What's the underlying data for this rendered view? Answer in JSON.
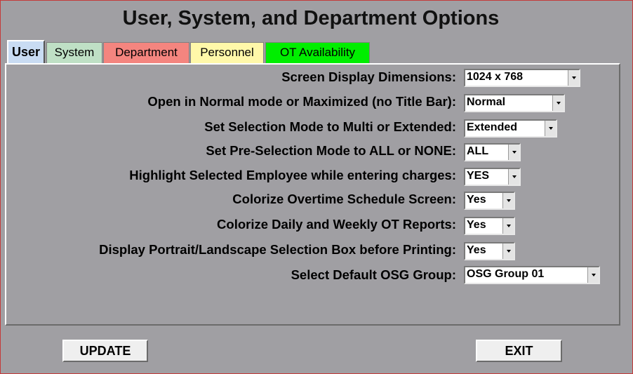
{
  "window_title": "User, System, and Department Options",
  "tabs": [
    {
      "label": "User",
      "color": "#c9dcf3",
      "active": true
    },
    {
      "label": "System",
      "color": "#bfe0c5",
      "active": false
    },
    {
      "label": "Department",
      "color": "#f4857f",
      "active": false
    },
    {
      "label": "Personnel",
      "color": "#fff8a9",
      "active": false
    },
    {
      "label": "OT Availability",
      "color": "#00ee00",
      "active": false
    }
  ],
  "options": [
    {
      "label": "Screen Display Dimensions:",
      "value": "1024 x 768"
    },
    {
      "label": "Open in Normal mode or Maximized (no Title Bar):",
      "value": "Normal"
    },
    {
      "label": "Set Selection Mode to Multi or Extended:",
      "value": "Extended"
    },
    {
      "label": "Set Pre-Selection Mode to ALL or NONE:",
      "value": "ALL"
    },
    {
      "label": "Highlight Selected Employee while entering charges:",
      "value": "YES"
    },
    {
      "label": "Colorize Overtime Schedule Screen:",
      "value": "Yes"
    },
    {
      "label": "Colorize Daily and Weekly OT Reports:",
      "value": "Yes"
    },
    {
      "label": "Display Portrait/Landscape Selection Box before Printing:",
      "value": "Yes"
    },
    {
      "label": "Select Default OSG Group:",
      "value": "OSG Group 01"
    }
  ],
  "buttons": {
    "update_label": "UPDATE",
    "exit_label": "EXIT"
  },
  "colors": {
    "background": "#a09fa3",
    "frame_border": "#c43a3a"
  }
}
